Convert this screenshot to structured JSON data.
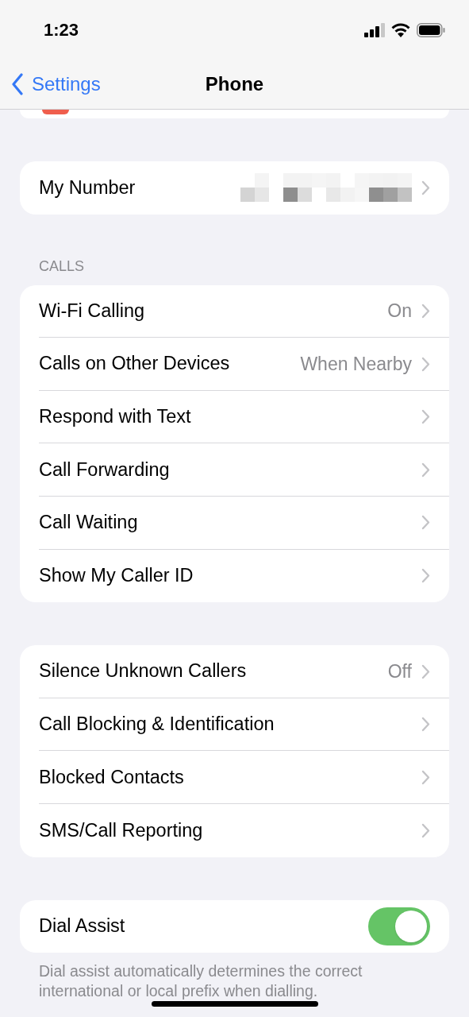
{
  "status_bar": {
    "time": "1:23"
  },
  "nav": {
    "back": "Settings",
    "title": "Phone"
  },
  "groups": [
    {
      "rows": [
        {
          "kind": "link",
          "label": "My Number",
          "redacted": true
        }
      ]
    },
    {
      "header": "CALLS",
      "rows": [
        {
          "kind": "link",
          "label": "Wi-Fi Calling",
          "value": "On"
        },
        {
          "kind": "link",
          "label": "Calls on Other Devices",
          "value": "When Nearby"
        },
        {
          "kind": "link",
          "label": "Respond with Text"
        },
        {
          "kind": "link",
          "label": "Call Forwarding"
        },
        {
          "kind": "link",
          "label": "Call Waiting"
        },
        {
          "kind": "link",
          "label": "Show My Caller ID"
        }
      ]
    },
    {
      "rows": [
        {
          "kind": "link",
          "label": "Silence Unknown Callers",
          "value": "Off"
        },
        {
          "kind": "link",
          "label": "Call Blocking & Identification"
        },
        {
          "kind": "link",
          "label": "Blocked Contacts"
        },
        {
          "kind": "link",
          "label": "SMS/Call Reporting"
        }
      ]
    },
    {
      "rows": [
        {
          "kind": "toggle",
          "label": "Dial Assist",
          "on": true
        }
      ],
      "footer": "Dial assist automatically determines the correct international or local prefix when dialling."
    }
  ]
}
